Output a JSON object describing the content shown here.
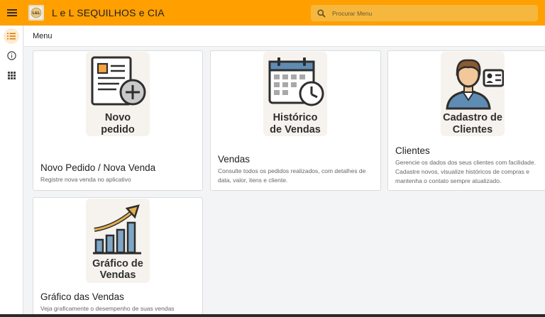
{
  "app": {
    "title": "L e L SEQUILHOS e CIA",
    "logo_text": "L&L"
  },
  "search": {
    "placeholder": "Procurar Menu"
  },
  "rail": {
    "items": [
      "list",
      "info",
      "apps"
    ]
  },
  "breadcrumb": {
    "label": "Menu"
  },
  "cards": [
    {
      "image_label_lines": [
        "Novo",
        "pedido"
      ],
      "title": "Novo Pedido / Nova Venda",
      "description": "Registre nova venda no aplicativo"
    },
    {
      "image_label_lines": [
        "Histórico",
        "de Vendas"
      ],
      "title": "Vendas",
      "description": "Consulte todos os pedidos realizados, com detalhes de data, valor, itens e cliente."
    },
    {
      "image_label_lines": [
        "Cadastro de",
        "Clientes"
      ],
      "title": "Clientes",
      "description": "Gerencie os dados dos seus clientes com facilidade. Cadastre novos, visualize históricos de compras e mantenha o contato sempre atualizado."
    },
    {
      "image_label_lines": [
        "Gráfico de",
        "Vendas"
      ],
      "title": "Gráfico das Vendas",
      "description": "Veja graficamente o desempenho de suas vendas"
    }
  ],
  "colors": {
    "appbar": "#ffa000",
    "search_bg": "#f5b73e",
    "icon_tile": "#f6f3ee",
    "accent_orange": "#f4a340",
    "icon_blue": "#5e8cb3"
  }
}
